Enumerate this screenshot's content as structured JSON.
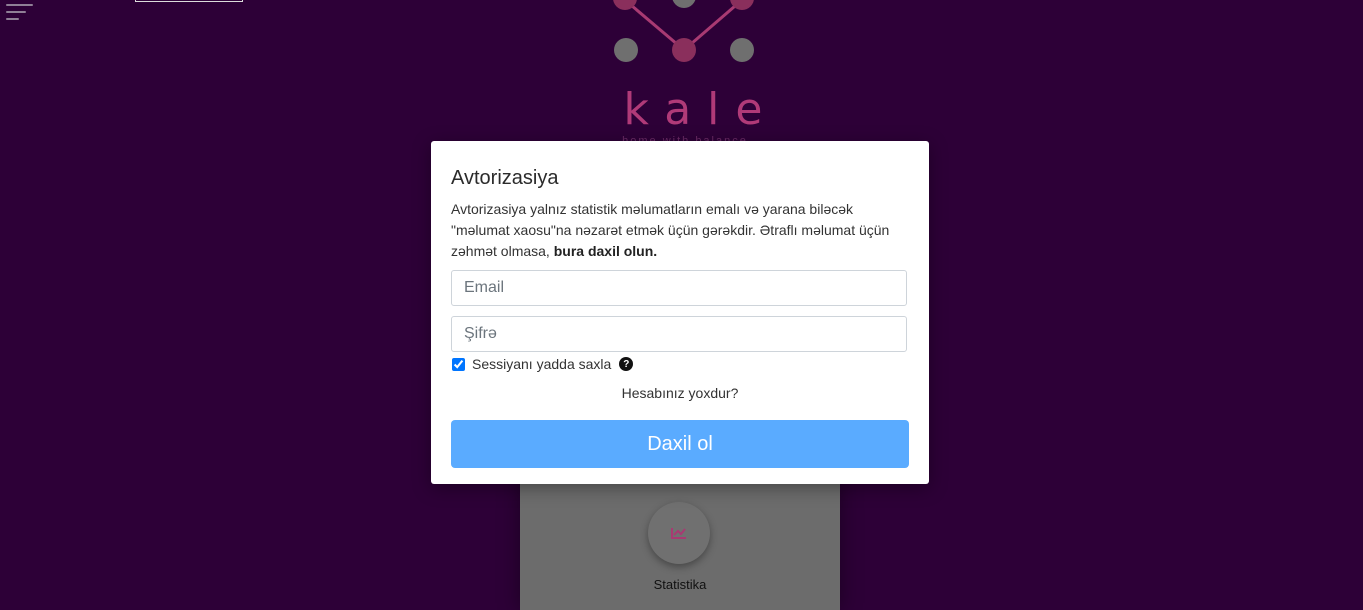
{
  "brand": {
    "name": "kale",
    "tagline": "home with balance"
  },
  "colors": {
    "background": "#2d0037",
    "brand": "#b03a78",
    "button": "#5aabff"
  },
  "icons": {
    "menu": "menu-icon",
    "help": "question-circle-icon",
    "stats": "chart-line-icon"
  },
  "background_card": {
    "label": "Statistika"
  },
  "modal": {
    "title": "Avtorizasiya",
    "description": "Avtorizasiya yalnız statistik məlumatların emalı və yarana biləcək \"məlumat xaosu\"na nəzarət etmək üçün gərəkdir. Ətraflı məlumat üçün zəhmət olmasa,",
    "description_link": "bura daxil olun.",
    "email_placeholder": "Email",
    "password_placeholder": "Şifrə",
    "remember_label": "Sessiyanı yadda saxla",
    "help_glyph": "?",
    "register_link": "Hesabınız yoxdur?",
    "submit_label": "Daxil ol"
  }
}
